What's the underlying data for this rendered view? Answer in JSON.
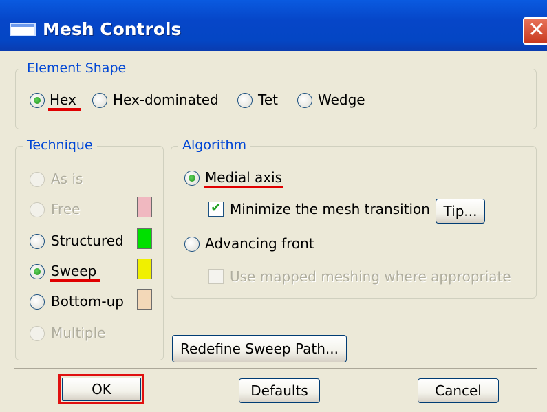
{
  "window": {
    "title": "Mesh Controls",
    "close_glyph": "✕"
  },
  "element_shape": {
    "legend": "Element Shape",
    "options": [
      "Hex",
      "Hex-dominated",
      "Tet",
      "Wedge"
    ],
    "selected": "Hex"
  },
  "technique": {
    "legend": "Technique",
    "options": [
      {
        "label": "As is",
        "enabled": false,
        "swatch": null
      },
      {
        "label": "Free",
        "enabled": false,
        "swatch": "#f0b8c0"
      },
      {
        "label": "Structured",
        "enabled": true,
        "swatch": "#00e000"
      },
      {
        "label": "Sweep",
        "enabled": true,
        "swatch": "#f0f000"
      },
      {
        "label": "Bottom-up",
        "enabled": true,
        "swatch": "#f3d8b8"
      },
      {
        "label": "Multiple",
        "enabled": false,
        "swatch": null
      }
    ],
    "selected": "Sweep"
  },
  "algorithm": {
    "legend": "Algorithm",
    "medial_axis": "Medial axis",
    "minimize_transition": "Minimize the mesh transition",
    "minimize_checked": true,
    "tip_button": "Tip...",
    "advancing_front": "Advancing front",
    "use_mapped": "Use mapped meshing where appropriate",
    "use_mapped_checked": false,
    "selected": "Medial axis"
  },
  "redefine_button": "Redefine Sweep Path...",
  "buttons": {
    "ok": "OK",
    "defaults": "Defaults",
    "cancel": "Cancel"
  },
  "highlight_color": "#e00000"
}
